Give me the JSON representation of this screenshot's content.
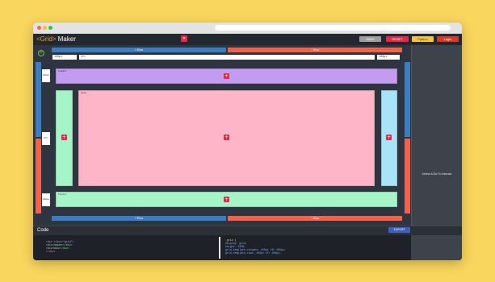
{
  "toolbar": {
    "logo_tag": "<Grid>",
    "logo_text": "Maker",
    "trash_icon": "trash-icon",
    "save_label": "SAVE",
    "reset_label": "RESET",
    "python_label": "Python",
    "login_label": "Login",
    "colors": {
      "save": "#9e9e9e",
      "reset": "#e0294b",
      "python": "#f5c542",
      "login": "#d33a2c"
    }
  },
  "editor": {
    "add_row_label": "Row",
    "remove_row_label": "Row",
    "col_inputs": [
      "100px",
      "1fr",
      "100px"
    ],
    "row_inputs": [
      "100px",
      "1fr",
      "100px"
    ],
    "vertical_add_label": "+ Col",
    "vertical_remove_label": "− Col",
    "areas": [
      {
        "name": "header",
        "color": "#c39bef"
      },
      {
        "name": "sidebar",
        "color": "#a6f5c8"
      },
      {
        "name": "main",
        "color": "#ffb5c8"
      },
      {
        "name": "sidebar2",
        "color": "#a8e3f7"
      },
      {
        "name": "footer",
        "color": "#a6f5c8"
      }
    ]
  },
  "side_panel": {
    "message": "Select A Div To Interact"
  },
  "code": {
    "title": "Code",
    "export_label": "EXPORT",
    "html_lines": [
      "<div class=\"grid\">",
      "  <div>header</div>",
      "  <div>main</div>",
      "</div>"
    ],
    "css_lines": [
      ".grid {",
      "  display: grid;",
      "  height: 100%;",
      "  grid-template-columns: 100px 1fr 100px;",
      "  grid-template-rows: 100px 1fr 100px;"
    ]
  }
}
